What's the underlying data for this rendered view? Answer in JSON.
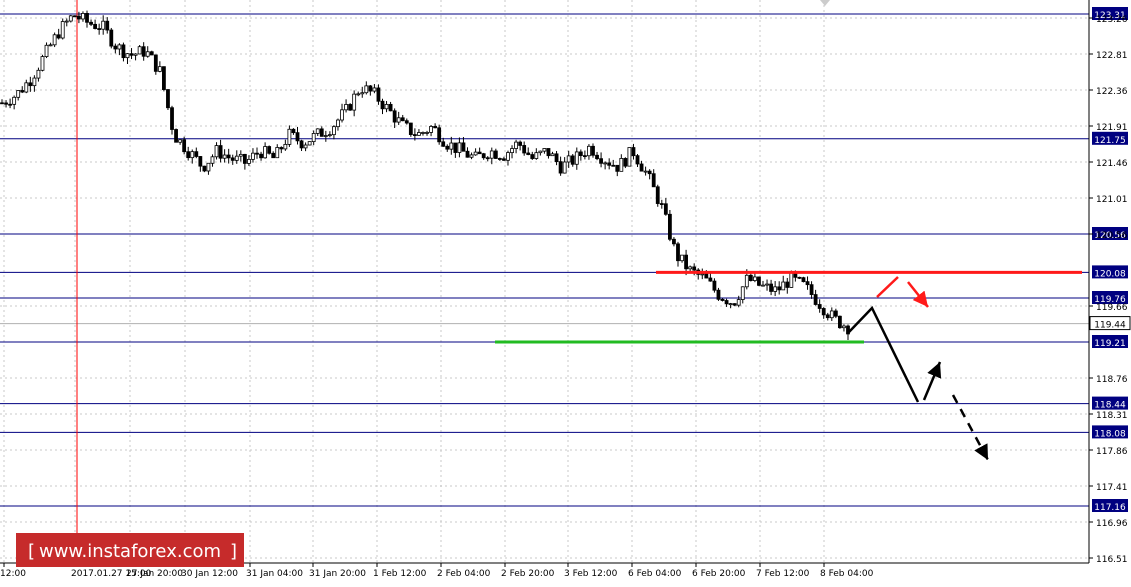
{
  "chart_data": {
    "type": "candlestick",
    "instrument_note": "",
    "y_axis": {
      "min": 116.51,
      "max": 123.31,
      "tick_labels": [
        "123.26",
        "122.81",
        "122.36",
        "121.91",
        "121.46",
        "121.01",
        "120.56",
        "119.66",
        "118.76",
        "118.31",
        "117.86",
        "117.41",
        "116.96",
        "116.51"
      ],
      "tick_values": [
        123.26,
        122.81,
        122.36,
        121.91,
        121.46,
        121.01,
        120.56,
        119.66,
        118.76,
        118.31,
        117.86,
        117.41,
        116.96,
        116.51
      ],
      "current_price_label": "119.44",
      "current_price": 119.44
    },
    "x_axis": {
      "tick_labels": [
        "12:00",
        "2017.01.27 15:00",
        "27 Jan 20:00",
        "30 Jan 12:00",
        "31 Jan 04:00",
        "31 Jan 20:00",
        "1 Feb 12:00",
        "2 Feb 04:00",
        "2 Feb 20:00",
        "3 Feb 12:00",
        "6 Feb 04:00",
        "6 Feb 20:00",
        "7 Feb 12:00",
        "8 Feb 04:00"
      ]
    },
    "levels": [
      {
        "value": 123.31,
        "label": "123.31"
      },
      {
        "value": 121.75,
        "label": "121.75"
      },
      {
        "value": 120.56,
        "label": "120.56"
      },
      {
        "value": 120.08,
        "label": "120.08"
      },
      {
        "value": 119.76,
        "label": "119.76"
      },
      {
        "value": 119.21,
        "label": "119.21"
      },
      {
        "value": 118.44,
        "label": "118.44"
      },
      {
        "value": 118.08,
        "label": "118.08"
      },
      {
        "value": 117.16,
        "label": "117.16"
      }
    ],
    "resistance_line": {
      "value": 120.08,
      "color": "#ff1a1a"
    },
    "support_line": {
      "value": 119.21,
      "color": "#22bb22"
    },
    "vertical_marker_color": "#ff0000",
    "grid": true,
    "close_path": [
      122.2,
      122.3,
      122.5,
      122.8,
      123.1,
      123.3,
      123.2,
      123.15,
      122.9,
      122.8,
      122.85,
      122.6,
      121.8,
      121.6,
      121.4,
      121.6,
      121.5,
      121.45,
      121.6,
      121.5,
      121.8,
      121.7,
      121.8,
      121.9,
      122.1,
      122.4,
      122.3,
      122.1,
      121.9,
      121.8,
      121.9,
      121.7,
      121.6,
      121.5,
      121.6,
      121.55,
      121.7,
      121.5,
      121.6,
      121.4,
      121.5,
      121.65,
      121.5,
      121.4,
      121.6,
      121.3,
      120.9,
      120.3,
      120.1,
      120.0,
      119.8,
      119.7,
      120.0,
      119.9,
      119.85,
      120.0,
      119.9,
      119.7,
      119.5,
      119.4
    ],
    "projection_black": [
      [
        119.42
      ],
      [
        119.66
      ],
      [
        118.44
      ],
      [
        118.9
      ]
    ],
    "projection_black_dashed": [
      [
        118.6
      ],
      [
        117.8
      ]
    ],
    "projection_red": [
      [
        119.8
      ],
      [
        120.0
      ],
      [
        119.66
      ]
    ]
  },
  "watermark": {
    "text": "www.instaforex.com"
  }
}
